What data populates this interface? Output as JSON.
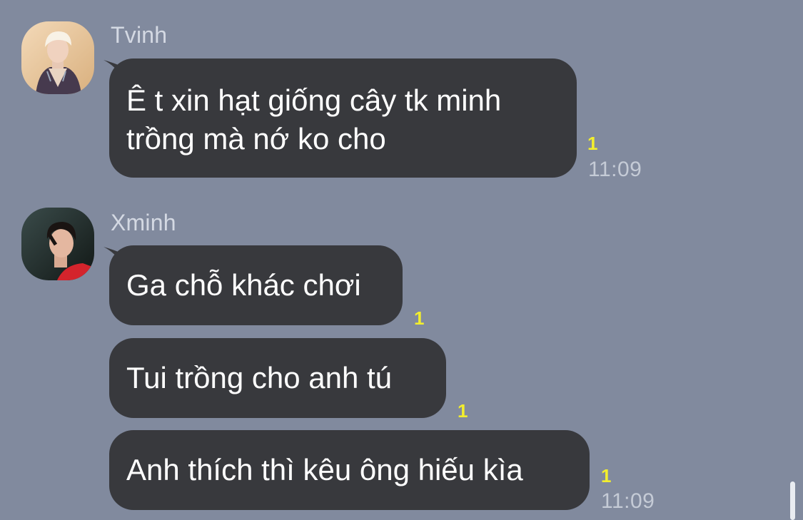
{
  "messages": [
    {
      "sender": "Tvinh",
      "avatar_icon": "profile-photo-blonde",
      "lines": [
        "Ê t xin hạt giống cây tk minh",
        "trồng mà nớ ko cho"
      ],
      "unread_count": "1",
      "time": "11:09"
    },
    {
      "sender": "Xminh",
      "avatar_icon": "profile-photo-dark-hair",
      "bubbles": [
        {
          "text": "Ga chỗ khác chơi",
          "unread_count": "1"
        },
        {
          "text": "Tui trồng cho anh tú",
          "unread_count": "1"
        },
        {
          "text": "Anh thích thì kêu ông hiếu kìa",
          "unread_count": "1",
          "time": "11:09"
        }
      ]
    }
  ],
  "colors": {
    "background": "#818a9e",
    "bubble": "#38393d",
    "bubble_text": "#ffffff",
    "unread": "#f2ee2e",
    "sender_name": "#d4d9e3",
    "timestamp": "#c5cbd6"
  }
}
